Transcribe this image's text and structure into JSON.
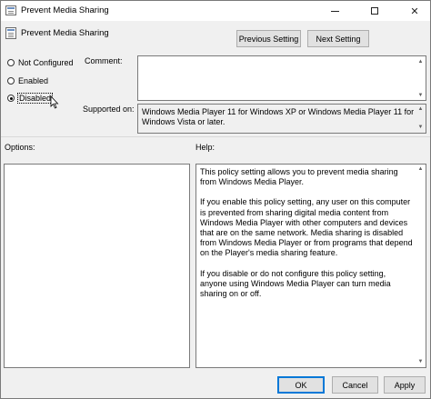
{
  "window": {
    "title": "Prevent Media Sharing",
    "controls": {
      "minimize": "—",
      "maximize": "□",
      "close": "✕"
    }
  },
  "header": {
    "title": "Prevent Media Sharing",
    "prev_button": "Previous Setting",
    "next_button": "Next Setting"
  },
  "state": {
    "options": [
      {
        "label": "Not Configured",
        "selected": false
      },
      {
        "label": "Enabled",
        "selected": false
      },
      {
        "label": "Disabled",
        "selected": true
      }
    ]
  },
  "comment": {
    "label": "Comment:",
    "value": ""
  },
  "supported": {
    "label": "Supported on:",
    "value": "Windows Media Player 11 for Windows XP or Windows Media Player 11 for Windows Vista or later."
  },
  "panels": {
    "options_label": "Options:",
    "help_label": "Help:"
  },
  "help": {
    "paragraphs": [
      "This policy setting allows you to prevent media sharing from Windows Media Player.",
      "If you enable this policy setting, any user on this computer is prevented from sharing digital media content from Windows Media Player with other computers and devices that are on the same network. Media sharing is disabled from Windows Media Player or from programs that depend on the Player's media sharing feature.",
      "If you disable or do not configure this policy setting, anyone using Windows Media Player can turn media sharing on or off."
    ]
  },
  "footer": {
    "ok": "OK",
    "cancel": "Cancel",
    "apply": "Apply"
  },
  "icons": {
    "scroll_up": "▲",
    "scroll_down": "▼"
  }
}
